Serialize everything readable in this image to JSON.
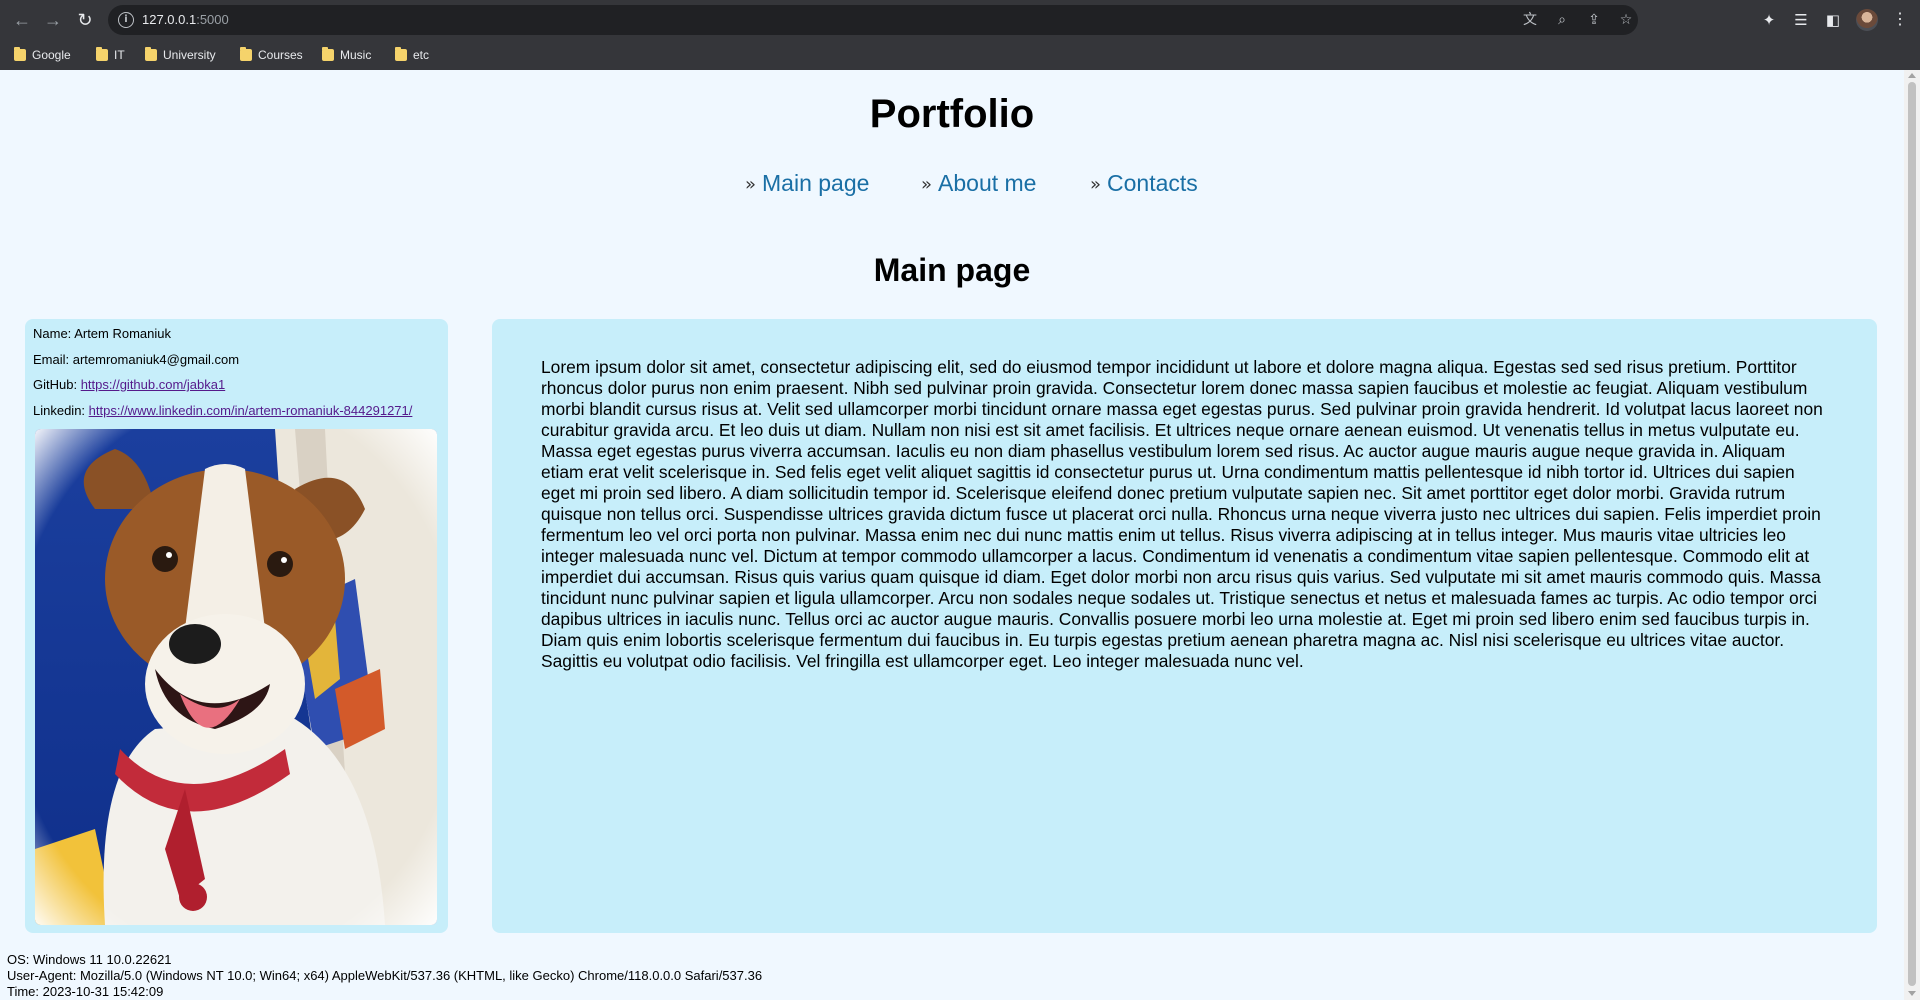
{
  "browser": {
    "url_host": "127.0.0.1",
    "url_port": ":5000",
    "bookmarks": [
      "Google",
      "IT",
      "University",
      "Courses",
      "Music",
      "etc"
    ]
  },
  "page": {
    "title": "Portfolio",
    "nav": [
      "Main page",
      "About me",
      "Contacts"
    ],
    "section_title": "Main page"
  },
  "profile": {
    "name_label": "Name: ",
    "name": "Artem Romaniuk",
    "email_label": "Email: ",
    "email": "artemromaniuk4@gmail.com",
    "github_label": "GitHub: ",
    "github": "https://github.com/jabka1",
    "linkedin_label": "Linkedin: ",
    "linkedin": "https://www.linkedin.com/in/artem-romaniuk-844291271/",
    "photo_subject": "dog-in-embroidered-shirt"
  },
  "content": {
    "text": "Lorem ipsum dolor sit amet, consectetur adipiscing elit, sed do eiusmod tempor incididunt ut labore et dolore magna aliqua. Egestas sed sed risus pretium. Porttitor rhoncus dolor purus non enim praesent. Nibh sed pulvinar proin gravida. Consectetur lorem donec massa sapien faucibus et molestie ac feugiat. Aliquam vestibulum morbi blandit cursus risus at. Velit sed ullamcorper morbi tincidunt ornare massa eget egestas purus. Sed pulvinar proin gravida hendrerit. Id volutpat lacus laoreet non curabitur gravida arcu. Et leo duis ut diam. Nullam non nisi est sit amet facilisis. Et ultrices neque ornare aenean euismod. Ut venenatis tellus in metus vulputate eu. Massa eget egestas purus viverra accumsan. Iaculis eu non diam phasellus vestibulum lorem sed risus. Ac auctor augue mauris augue neque gravida in. Aliquam etiam erat velit scelerisque in. Sed felis eget velit aliquet sagittis id consectetur purus ut. Urna condimentum mattis pellentesque id nibh tortor id. Ultrices dui sapien eget mi proin sed libero. A diam sollicitudin tempor id. Scelerisque eleifend donec pretium vulputate sapien nec. Sit amet porttitor eget dolor morbi. Gravida rutrum quisque non tellus orci. Suspendisse ultrices gravida dictum fusce ut placerat orci nulla. Rhoncus urna neque viverra justo nec ultrices dui sapien. Felis imperdiet proin fermentum leo vel orci porta non pulvinar. Massa enim nec dui nunc mattis enim ut tellus. Risus viverra adipiscing at in tellus integer. Mus mauris vitae ultricies leo integer malesuada nunc vel. Dictum at tempor commodo ullamcorper a lacus. Condimentum id venenatis a condimentum vitae sapien pellentesque. Commodo elit at imperdiet dui accumsan. Risus quis varius quam quisque id diam. Eget dolor morbi non arcu risus quis varius. Sed vulputate mi sit amet mauris commodo quis. Massa tincidunt nunc pulvinar sapien et ligula ullamcorper. Arcu non sodales neque sodales ut. Tristique senectus et netus et malesuada fames ac turpis. Ac odio tempor orci dapibus ultrices in iaculis nunc. Tellus orci ac auctor augue mauris. Convallis posuere morbi leo urna molestie at. Eget mi proin sed libero enim sed faucibus turpis in. Diam quis enim lobortis scelerisque fermentum dui faucibus in. Eu turpis egestas pretium aenean pharetra magna ac. Nisl nisi scelerisque eu ultrices vitae auctor. Sagittis eu volutpat odio facilisis. Vel fringilla est ullamcorper eget. Leo integer malesuada nunc vel."
  },
  "footer": {
    "os": "OS: Windows 11 10.0.22621",
    "user_agent": "User-Agent: Mozilla/5.0 (Windows NT 10.0; Win64; x64) AppleWebKit/537.36 (KHTML, like Gecko) Chrome/118.0.0.0 Safari/537.36",
    "time": "Time: 2023-10-31 15:42:09"
  },
  "colors": {
    "page_bg": "#f0f8ff",
    "card_bg": "#c7eefa",
    "nav_link": "#1a6fa5",
    "chrome_bg": "#35363a"
  },
  "icons": {
    "toolbar": [
      "back-icon",
      "forward-icon",
      "reload-icon"
    ],
    "omnibox": [
      "info-icon",
      "translate-icon",
      "zoom-icon",
      "share-icon",
      "bookmark-star-icon"
    ],
    "extensions": [
      "extensions-puzzle-icon",
      "reading-list-icon",
      "side-panel-icon",
      "profile-avatar-icon",
      "menu-dots-icon"
    ]
  }
}
